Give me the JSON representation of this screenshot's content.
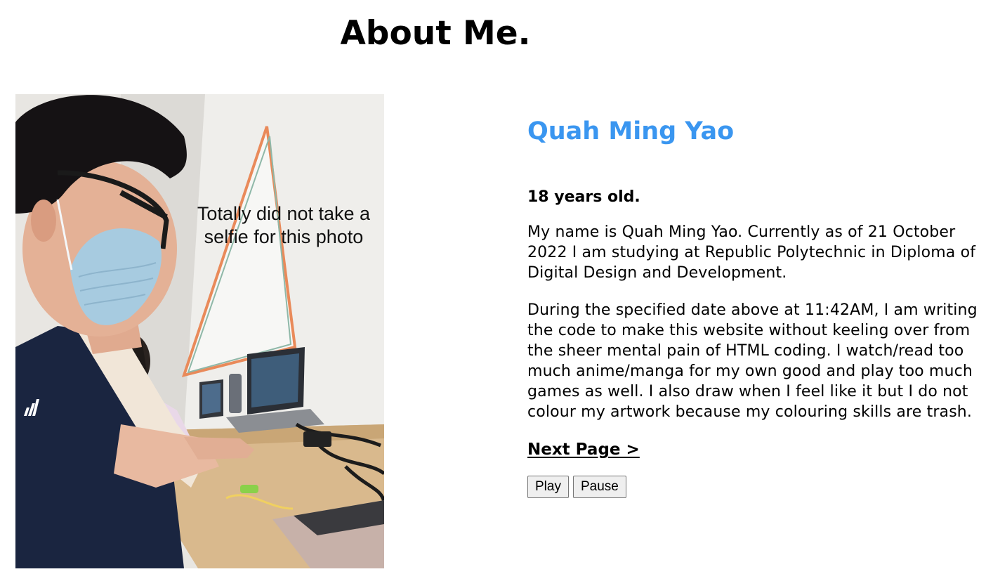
{
  "page": {
    "title": "About Me."
  },
  "photo": {
    "caption": "Totally did not take a selfie for this photo",
    "shirt_logo_text": "adidas"
  },
  "profile": {
    "name": "Quah Ming Yao",
    "age": "18 years old.",
    "paragraphs": [
      "My name is Quah Ming Yao. Currently as of 21 October 2022 I am studying at Republic Polytechnic in Diploma of Digital Design and Development.",
      "During the specified date above at 11:42AM, I am writing the code to make this website without keeling over from the sheer mental pain of HTML coding. I watch/read too much anime/manga for my own good and play too much games as well. I also draw when I feel like it but I do not colour my artwork because my colouring skills are trash."
    ],
    "next_link": "Next Page >"
  },
  "media": {
    "play_label": "Play",
    "pause_label": "Pause"
  },
  "colors": {
    "name_accent": "#3a96f0"
  }
}
